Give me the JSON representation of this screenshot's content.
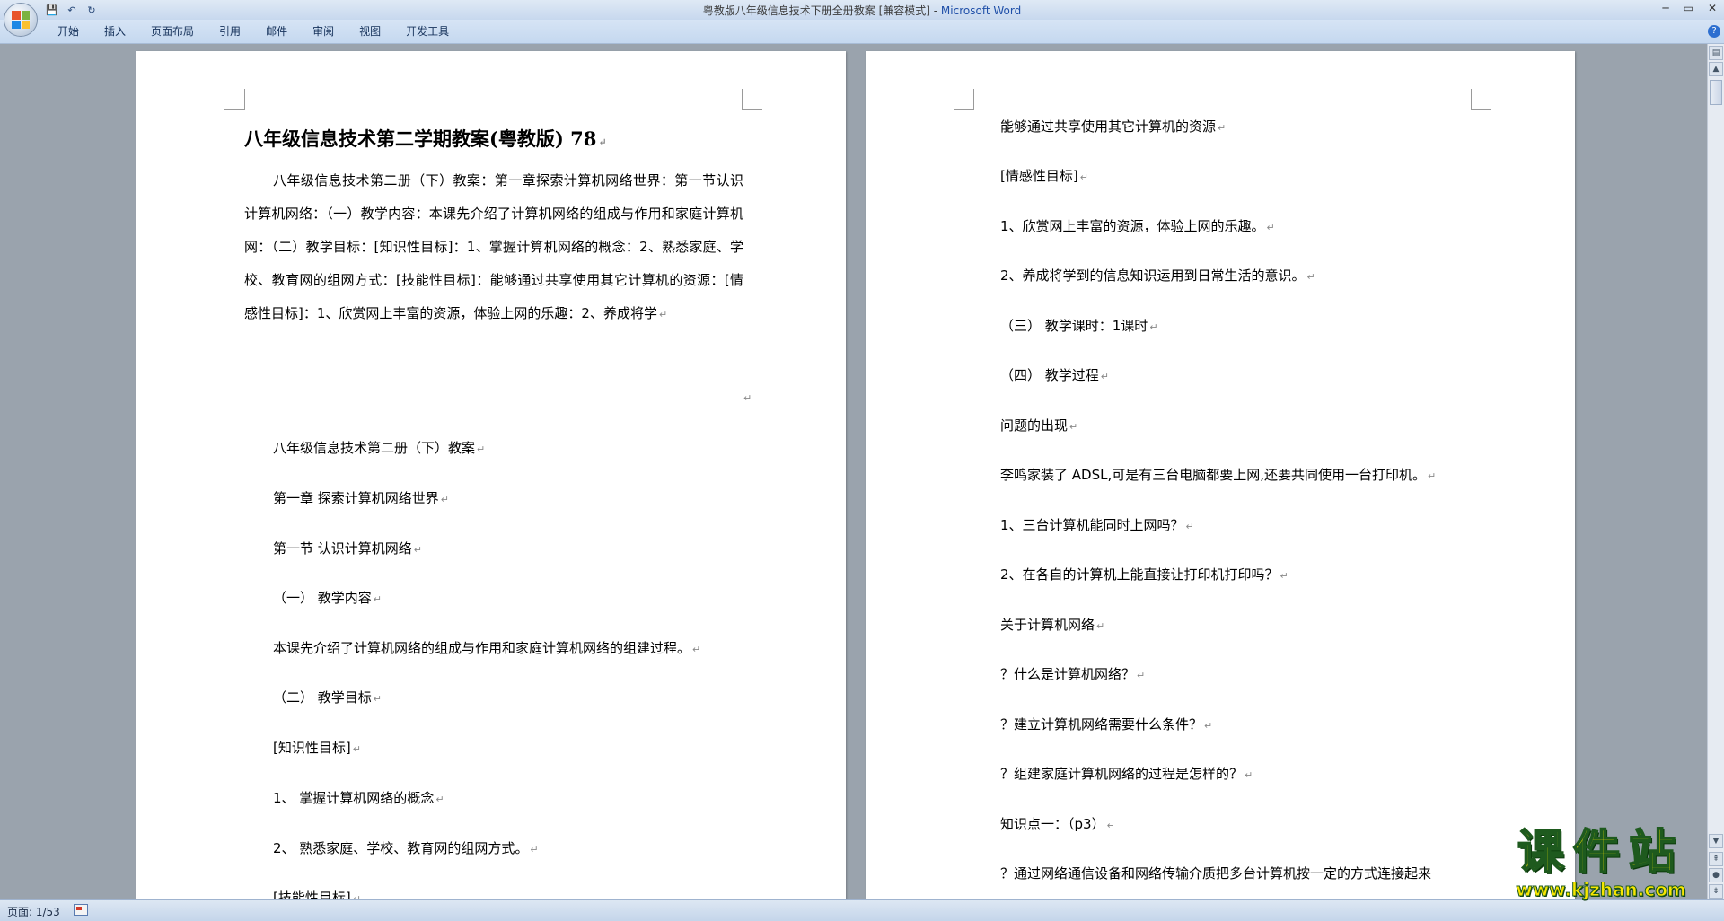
{
  "window": {
    "title": "粤教版八年级信息技术下册全册教案 [兼容模式] - ",
    "app_name": "Microsoft Word"
  },
  "quick_access": {
    "save": "💾",
    "undo": "↶",
    "redo": "↻"
  },
  "ribbon": {
    "tabs": [
      "开始",
      "插入",
      "页面布局",
      "引用",
      "邮件",
      "审阅",
      "视图",
      "开发工具"
    ],
    "help": "?"
  },
  "paragraph_mark": "↵",
  "left_page": {
    "heading": "八年级信息技术第二学期教案(粤教版) 78",
    "intro": "八年级信息技术第二册（下）教案：第一章探索计算机网络世界：第一节认识计算机网络：（一）教学内容：本课先介绍了计算机网络的组成与作用和家庭计算机网：（二）教学目标：[知识性目标]：1、掌握计算机网络的概念：2、熟悉家庭、学校、教育网的组网方式：[技能性目标]：能够通过共享使用其它计算机的资源：[情感性目标]：1、欣赏网上丰富的资源，体验上网的乐趣：2、养成将学",
    "lines": [
      "八年级信息技术第二册（下）教案",
      "第一章 探索计算机网络世界",
      "第一节 认识计算机网络",
      "（一） 教学内容",
      "本课先介绍了计算机网络的组成与作用和家庭计算机网络的组建过程。",
      "（二） 教学目标",
      "[知识性目标]",
      "1、 掌握计算机网络的概念",
      "2、 熟悉家庭、学校、教育网的组网方式。",
      "[技能性目标]"
    ]
  },
  "right_page": {
    "lines": [
      "能够通过共享使用其它计算机的资源",
      "[情感性目标]",
      "1、欣赏网上丰富的资源，体验上网的乐趣。",
      "2、养成将学到的信息知识运用到日常生活的意识。",
      "（三） 教学课时：1课时",
      "（四） 教学过程",
      "问题的出现",
      "李鸣家装了 ADSL,可是有三台电脑都要上网,还要共同使用一台打印机。",
      "1、三台计算机能同时上网吗？",
      "2、在各自的计算机上能直接让打印机打印吗？",
      "关于计算机网络",
      "？什么是计算机网络？",
      "？建立计算机网络需要什么条件？",
      "？组建家庭计算机网络的过程是怎样的？",
      "知识点一：（p3）",
      "？通过网络通信设备和网络传输介质把多台计算机按一定的方式连接起来"
    ]
  },
  "status_bar": {
    "page": "页面: 1/53"
  },
  "watermark": {
    "title": "课件站",
    "url": "www.kjzhan.com"
  },
  "colors": {
    "office_logo": [
      "#e8552b",
      "#7cb342",
      "#1e88e5",
      "#fbc02d"
    ]
  }
}
